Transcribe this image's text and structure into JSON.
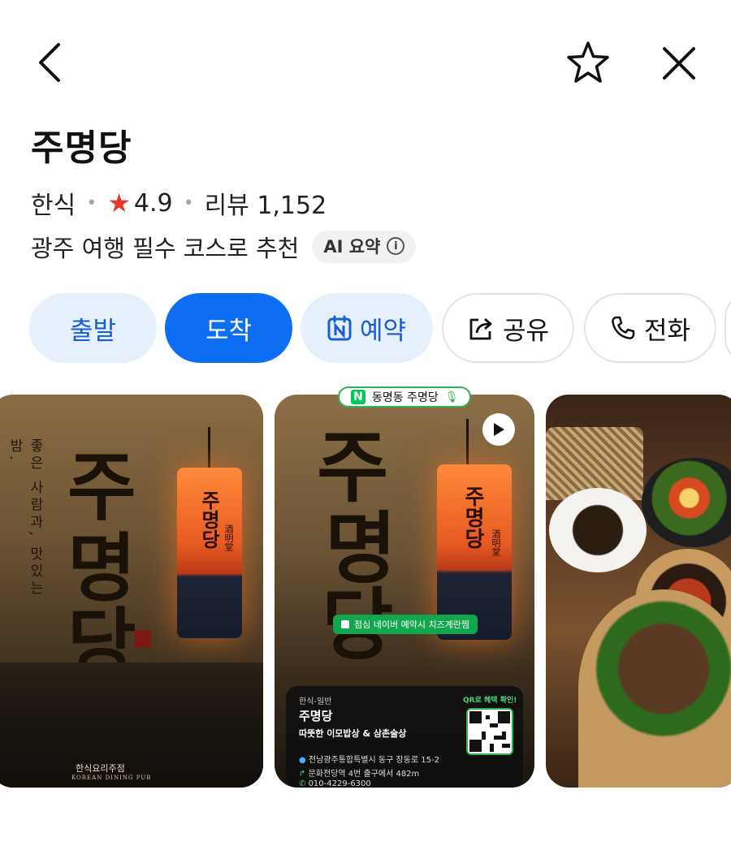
{
  "header": {
    "back": "back",
    "favorite": "favorite",
    "close": "close"
  },
  "place": {
    "name": "주명당",
    "category": "한식",
    "rating": "4.9",
    "reviews_label": "리뷰 1,152",
    "tagline": "광주 여행 필수 코스로 추천",
    "ai_chip": "AI 요약"
  },
  "actions": [
    {
      "label": "출발"
    },
    {
      "label": "도착"
    },
    {
      "label": "예약"
    },
    {
      "label": "공유"
    },
    {
      "label": "전화"
    }
  ],
  "gallery": {
    "card1": {
      "big_title": [
        "주",
        "명",
        "당"
      ],
      "vertical_text": "좋은 사람과, 맛있는 밤.",
      "lantern_text": "주명당",
      "lantern_small": "酒明堂",
      "footer": "한식요리주점",
      "footer_en": "KOREAN DINING PUB"
    },
    "card2": {
      "badge": "동명동 주명당",
      "big_title": [
        "주",
        "명",
        "당"
      ],
      "lantern_text": "주명당",
      "lantern_small": "酒明堂",
      "promo": "점심 네이버 예약시 치즈계란찜",
      "info": {
        "category": "한식-일반",
        "name": "주명당",
        "desc": "따뜻한 이모밥상 & 삼촌술상",
        "address": "전남광주통합특별시 동구 장동로 15-2",
        "station": "문화전당역 4번 출구에서 482m",
        "phone": "010-4229-6300",
        "qr_label": "QR로 혜택 확인!"
      }
    }
  },
  "colors": {
    "accent": "#0d6ef4",
    "accent_light": "#e6f0fd",
    "star": "#e8372f",
    "naver": "#03c75a"
  }
}
